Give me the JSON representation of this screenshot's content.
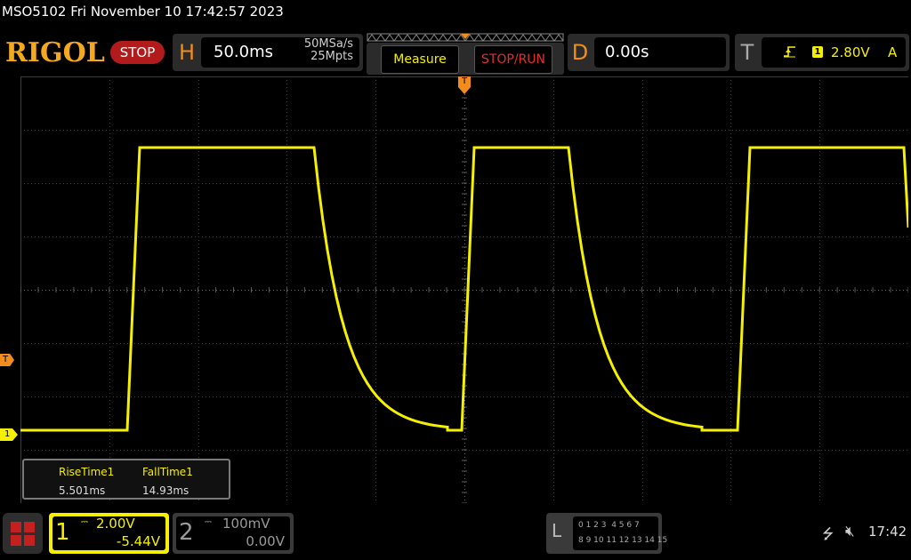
{
  "status_line": "MSO5102  Fri November 10 17:42:57 2023",
  "header": {
    "logo": "RIGOL",
    "run_state": "STOP",
    "horizontal": {
      "letter": "H",
      "scale": "50.0ms",
      "sample_rate": "50MSa/s",
      "memory_depth": "25Mpts"
    },
    "measure_button": "Measure",
    "stop_run_button": "STOP/RUN",
    "delay": {
      "letter": "D",
      "value": "0.00s"
    },
    "trigger": {
      "letter": "T",
      "level": "2.80V",
      "source": "A",
      "channel_badge": "1"
    }
  },
  "markers": {
    "trigger_level": "T",
    "channel1": "1",
    "trigger_pos": "T"
  },
  "measurements": {
    "headers": [
      "RiseTime1",
      "FallTime1"
    ],
    "values": [
      "5.501ms",
      "14.93ms"
    ]
  },
  "channels": [
    {
      "number": "1",
      "scale": "2.00V",
      "offset": "-5.44V",
      "color": "#f5f000",
      "active": true
    },
    {
      "number": "2",
      "scale": "100mV",
      "offset": "0.00V",
      "color": "#9a9a9a",
      "active": false
    }
  ],
  "logic_panel": {
    "letter": "L",
    "row1": "0 1 2 3  4 5 6 7",
    "row2": "8 9 10 11 12 13 14 15"
  },
  "system": {
    "clock": "17:42"
  },
  "icons": {
    "usb": "usb-icon",
    "mute": "speaker-mute-icon",
    "menu": "menu-grid-icon",
    "trigger_edge": "rising-edge-icon"
  },
  "colors": {
    "accent": "#f28c1c",
    "ch1": "#f5f000",
    "stop": "#b21b1b",
    "grid": "#4a4a4a"
  }
}
